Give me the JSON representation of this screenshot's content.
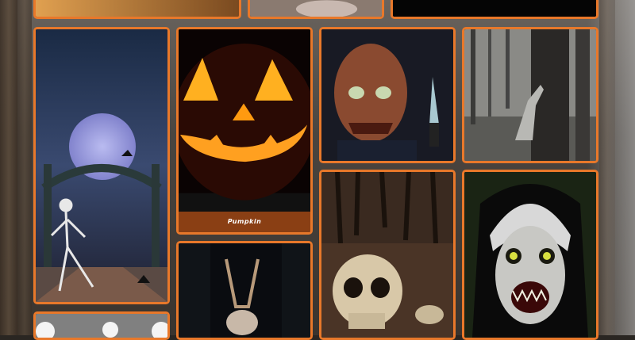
{
  "gallery": {
    "cards": [
      {
        "id": "top-left",
        "image": "halloween-photo",
        "caption": ""
      },
      {
        "id": "top-middle",
        "image": "halloween-photo",
        "caption": ""
      },
      {
        "id": "top-right",
        "image": "dark-photo",
        "caption": ""
      },
      {
        "id": "skeleton-bridge",
        "image": "skeleton-on-bridge-full-moon",
        "caption": ""
      },
      {
        "id": "pumpkin",
        "image": "jack-o-lantern",
        "caption": "Pumpkin"
      },
      {
        "id": "masked-man",
        "image": "man-in-mask-with-knife",
        "caption": ""
      },
      {
        "id": "hand-on-tree",
        "image": "zombie-hand-on-tree",
        "caption": ""
      },
      {
        "id": "skull-forest",
        "image": "skull-on-forest-floor",
        "caption": ""
      },
      {
        "id": "evil-nun",
        "image": "evil-nun-face",
        "caption": ""
      },
      {
        "id": "deer-skull",
        "image": "deer-skull-held",
        "caption": ""
      },
      {
        "id": "bottom-left",
        "image": "white-skulls",
        "caption": ""
      }
    ]
  },
  "colors": {
    "card_border": "#e8782a",
    "caption_bg": "#8a3f14"
  }
}
